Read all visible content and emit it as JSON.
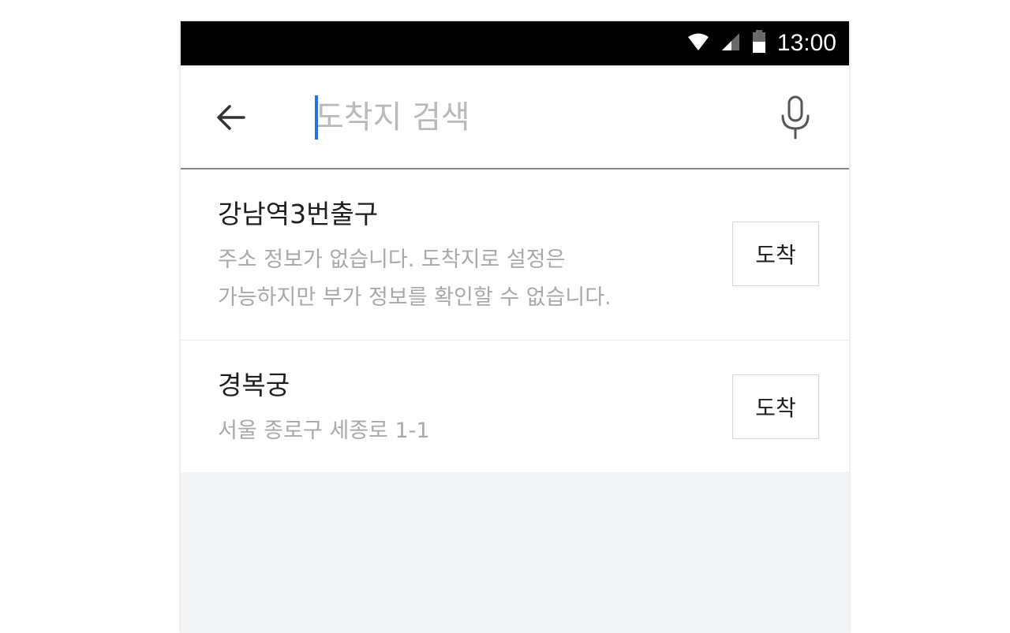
{
  "status_bar": {
    "time": "13:00",
    "icons": [
      "wifi-icon",
      "cellular-signal-icon",
      "battery-icon"
    ],
    "background": "#000000"
  },
  "search": {
    "placeholder": "도착지 검색",
    "value": "",
    "back_icon": "back-arrow-icon",
    "mic_icon": "microphone-icon",
    "caret_color": "#2a6ee8"
  },
  "results": [
    {
      "title": "강남역3번출구",
      "desc_line1": "주소 정보가 없습니다. 도착지로 설정은",
      "desc_line2": "가능하지만 부가 정보를 확인할 수 없습니다.",
      "button_label": "도착"
    },
    {
      "title": "경복궁",
      "desc_line1": "서울 종로구 세종로 1-1",
      "button_label": "도착"
    }
  ]
}
